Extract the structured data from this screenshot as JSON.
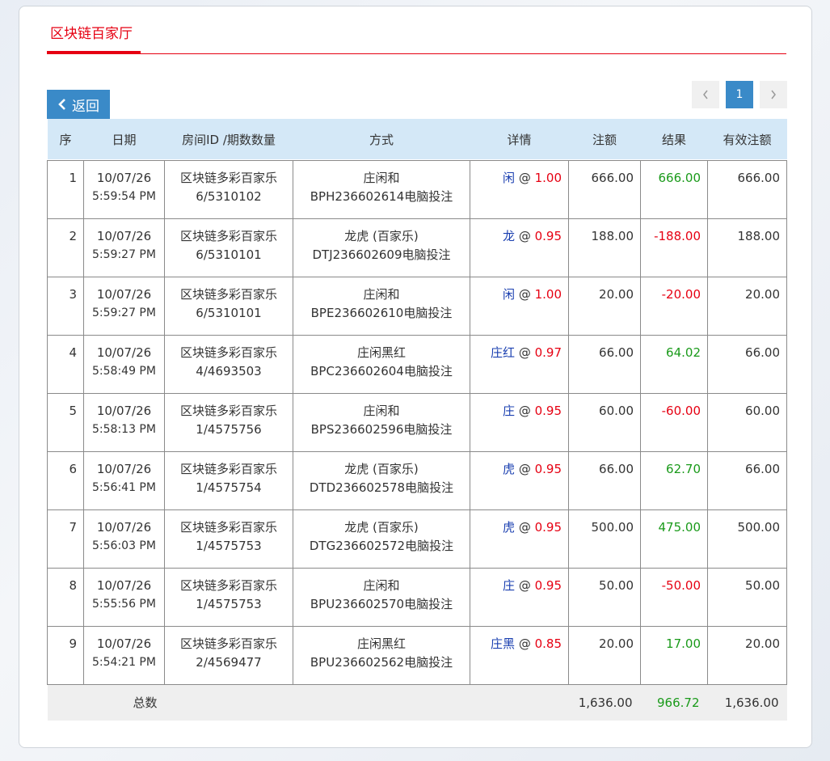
{
  "tab": {
    "label": "区块链百家厅"
  },
  "back_button": {
    "label": "返回"
  },
  "pagination": {
    "current": "1"
  },
  "table": {
    "headers": [
      "序",
      "日期",
      "房间ID /期数数量",
      "方式",
      "详情",
      "注额",
      "结果",
      "有效注额"
    ],
    "rows": [
      {
        "seq": "1",
        "date": "10/07/26",
        "time": "5:59:54 PM",
        "room": "区块链多彩百家乐",
        "period": "6/5310102",
        "mode": "庄闲和",
        "order": "BPH236602614电脑投注",
        "pick": "闲",
        "odds": "1.00",
        "amount": "666.00",
        "result": "666.00",
        "result_sign": "win",
        "effective": "666.00"
      },
      {
        "seq": "2",
        "date": "10/07/26",
        "time": "5:59:27 PM",
        "room": "区块链多彩百家乐",
        "period": "6/5310101",
        "mode": "龙虎 (百家乐)",
        "order": "DTJ236602609电脑投注",
        "pick": "龙",
        "odds": "0.95",
        "amount": "188.00",
        "result": "-188.00",
        "result_sign": "loss",
        "effective": "188.00"
      },
      {
        "seq": "3",
        "date": "10/07/26",
        "time": "5:59:27 PM",
        "room": "区块链多彩百家乐",
        "period": "6/5310101",
        "mode": "庄闲和",
        "order": "BPE236602610电脑投注",
        "pick": "闲",
        "odds": "1.00",
        "amount": "20.00",
        "result": "-20.00",
        "result_sign": "loss",
        "effective": "20.00"
      },
      {
        "seq": "4",
        "date": "10/07/26",
        "time": "5:58:49 PM",
        "room": "区块链多彩百家乐",
        "period": "4/4693503",
        "mode": "庄闲黑红",
        "order": "BPC236602604电脑投注",
        "pick": "庄红",
        "odds": "0.97",
        "amount": "66.00",
        "result": "64.02",
        "result_sign": "win",
        "effective": "66.00"
      },
      {
        "seq": "5",
        "date": "10/07/26",
        "time": "5:58:13 PM",
        "room": "区块链多彩百家乐",
        "period": "1/4575756",
        "mode": "庄闲和",
        "order": "BPS236602596电脑投注",
        "pick": "庄",
        "odds": "0.95",
        "amount": "60.00",
        "result": "-60.00",
        "result_sign": "loss",
        "effective": "60.00"
      },
      {
        "seq": "6",
        "date": "10/07/26",
        "time": "5:56:41 PM",
        "room": "区块链多彩百家乐",
        "period": "1/4575754",
        "mode": "龙虎 (百家乐)",
        "order": "DTD236602578电脑投注",
        "pick": "虎",
        "odds": "0.95",
        "amount": "66.00",
        "result": "62.70",
        "result_sign": "win",
        "effective": "66.00"
      },
      {
        "seq": "7",
        "date": "10/07/26",
        "time": "5:56:03 PM",
        "room": "区块链多彩百家乐",
        "period": "1/4575753",
        "mode": "龙虎 (百家乐)",
        "order": "DTG236602572电脑投注",
        "pick": "虎",
        "odds": "0.95",
        "amount": "500.00",
        "result": "475.00",
        "result_sign": "win",
        "effective": "500.00"
      },
      {
        "seq": "8",
        "date": "10/07/26",
        "time": "5:55:56 PM",
        "room": "区块链多彩百家乐",
        "period": "1/4575753",
        "mode": "庄闲和",
        "order": "BPU236602570电脑投注",
        "pick": "庄",
        "odds": "0.95",
        "amount": "50.00",
        "result": "-50.00",
        "result_sign": "loss",
        "effective": "50.00"
      },
      {
        "seq": "9",
        "date": "10/07/26",
        "time": "5:54:21 PM",
        "room": "区块链多彩百家乐",
        "period": "2/4569477",
        "mode": "庄闲黑红",
        "order": "BPU236602562电脑投注",
        "pick": "庄黑",
        "odds": "0.85",
        "amount": "20.00",
        "result": "17.00",
        "result_sign": "win",
        "effective": "20.00"
      }
    ],
    "total": {
      "label": "总数",
      "amount": "1,636.00",
      "result": "966.72",
      "effective": "1,636.00"
    }
  },
  "colors": {
    "accent_red": "#e60012",
    "button_blue": "#3a8ac8",
    "header_bg": "#d4e8f7",
    "win_green": "#1a9a1a",
    "pick_blue": "#1a3fb0"
  }
}
